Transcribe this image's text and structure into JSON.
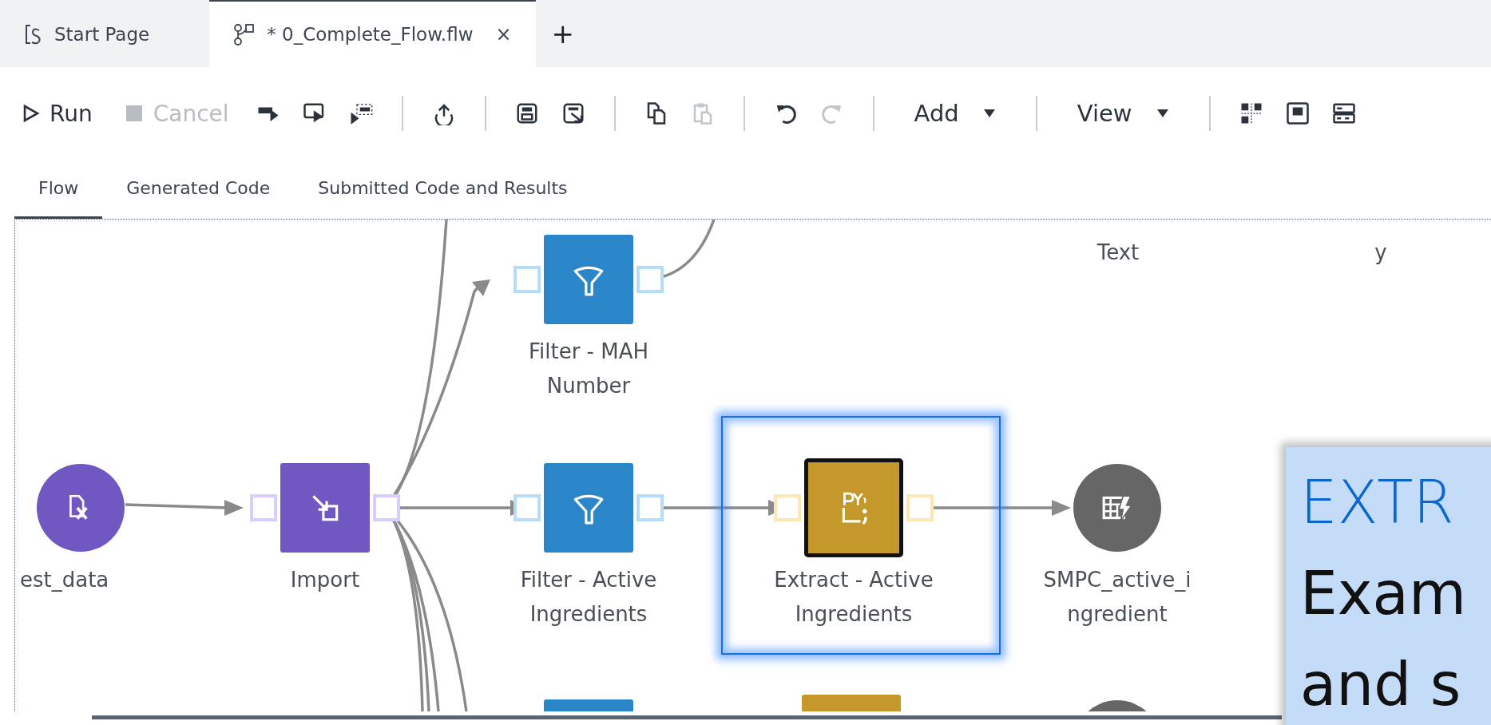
{
  "tabs": [
    {
      "label": "Start Page",
      "selected": false
    },
    {
      "label": "* 0_Complete_Flow.flw",
      "selected": true,
      "close": "×"
    }
  ],
  "new_tab": "+",
  "toolbar": [
    {
      "kind": "run",
      "label": "Run",
      "disabled": false
    },
    {
      "kind": "stop",
      "label": "Cancel",
      "disabled": true
    },
    {
      "kind": "icon",
      "disabled": false
    },
    {
      "kind": "icon",
      "disabled": false
    },
    {
      "kind": "icon",
      "disabled": false
    },
    {
      "kind": "separator"
    },
    {
      "kind": "icon",
      "disabled": false
    },
    {
      "kind": "separator"
    },
    {
      "kind": "icon",
      "disabled": false
    },
    {
      "kind": "icon",
      "disabled": false
    },
    {
      "kind": "separator"
    },
    {
      "kind": "icon",
      "disabled": false
    },
    {
      "kind": "icon",
      "disabled": true
    },
    {
      "kind": "separator"
    },
    {
      "kind": "icon",
      "disabled": false
    },
    {
      "kind": "icon",
      "disabled": true
    },
    {
      "kind": "separator"
    },
    {
      "kind": "menu",
      "label": "Add"
    },
    {
      "kind": "separator"
    },
    {
      "kind": "menu",
      "label": "View"
    },
    {
      "kind": "separator"
    },
    {
      "kind": "icon",
      "disabled": false
    },
    {
      "kind": "icon",
      "disabled": false
    },
    {
      "kind": "icon",
      "disabled": false
    }
  ],
  "view_tabs": [
    {
      "label": "Flow",
      "selected": true
    },
    {
      "label": "Generated Code",
      "selected": false
    },
    {
      "label": "Submitted Code and Results",
      "selected": false
    }
  ],
  "flow": {
    "nodes": [
      {
        "kind": "label",
        "label": "Text"
      },
      {
        "kind": "label",
        "label": "y"
      },
      {
        "kind": "filter",
        "label": "Filter - MAH Number",
        "selected": false
      },
      {
        "kind": "data",
        "label": "est_data",
        "selected": false
      },
      {
        "kind": "import",
        "label": "Import",
        "selected": false
      },
      {
        "kind": "filter",
        "label": "Filter - Active Ingredients",
        "selected": false
      },
      {
        "kind": "python",
        "label": "Extract - Active Ingredients",
        "selected": true
      },
      {
        "kind": "table",
        "label": "SMPC_active_i ngredient",
        "selected": false
      },
      {
        "kind": "filter"
      },
      {
        "kind": "python"
      },
      {
        "kind": "table"
      }
    ],
    "callout": {
      "title": "EXTR",
      "lines": [
        "Exam",
        "and s"
      ]
    }
  }
}
